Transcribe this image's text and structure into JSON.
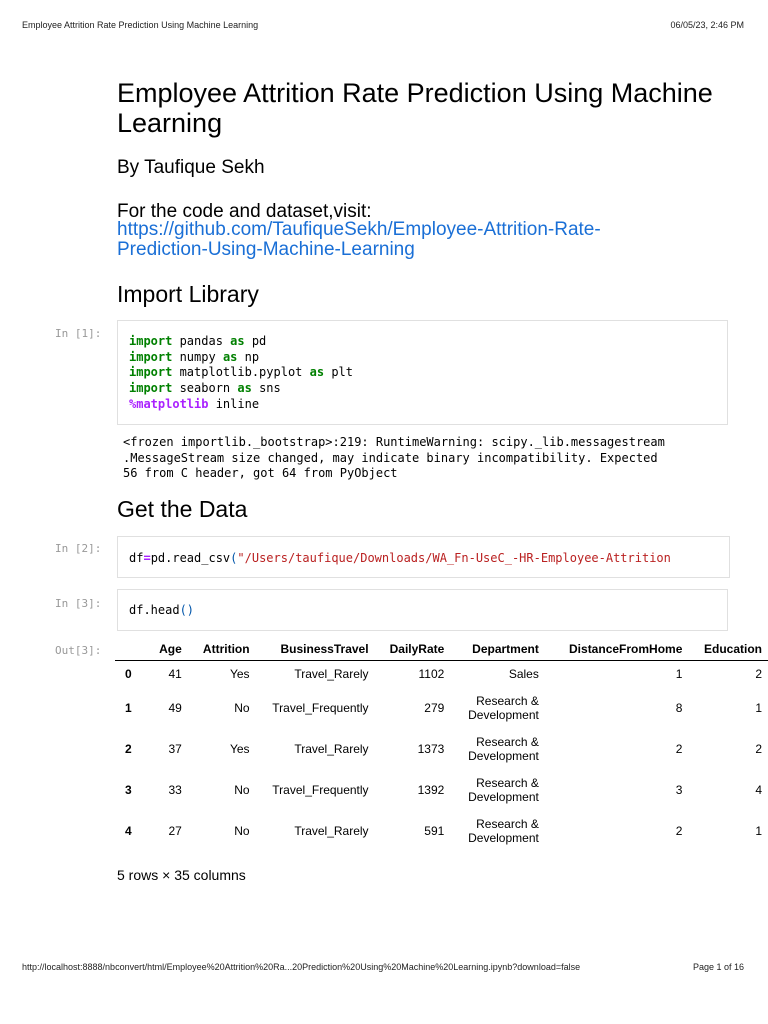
{
  "header": {
    "title": "Employee Attrition Rate Prediction Using Machine Learning",
    "datetime": "06/05/23, 2:46 PM"
  },
  "footer": {
    "url": "http://localhost:8888/nbconvert/html/Employee%20Attrition%20Ra...20Prediction%20Using%20Machine%20Learning.ipynb?download=false",
    "page": "Page 1 of 16"
  },
  "title": "Employee Attrition Rate Prediction Using Machine Learning",
  "author": "By Taufique Sekh",
  "visit_text": "For the code and dataset,visit:",
  "link": "https://github.com/TaufiqueSekh/Employee-Attrition-Rate-Prediction-Using-Machine-Learning",
  "link_line1": "https://github.com/TaufiqueSekh/Employee-Attrition-Rate-",
  "link_line2": "Prediction-Using-Machine-Learning",
  "section1": "Import Library",
  "section2": "Get the Data",
  "cell1": {
    "prompt": "In [1]:",
    "lines": [
      [
        "import",
        " pandas ",
        "as",
        " pd"
      ],
      [
        "import",
        " numpy ",
        "as",
        " np"
      ],
      [
        "import",
        " matplotlib.pyplot ",
        "as",
        " plt"
      ],
      [
        "import",
        " seaborn ",
        "as",
        " sns"
      ]
    ],
    "magic": "%matplotlib",
    "magic_rest": " inline"
  },
  "cell1_output": "<frozen importlib._bootstrap>:219: RuntimeWarning: scipy._lib.messagestream\n.MessageStream size changed, may indicate binary incompatibility. Expected\n56 from C header, got 64 from PyObject",
  "cell2": {
    "prompt": "In [2]:",
    "a": "df",
    "op": "=",
    "b": "pd.read_csv",
    "p": "(",
    "s": "\"/Users/taufique/Downloads/WA_Fn-UseC_-HR-Employee-Attrition"
  },
  "cell3": {
    "prompt": "In [3]:",
    "a": "df.head",
    "p": "()"
  },
  "out3": {
    "prompt": "Out[3]:",
    "columns": [
      "",
      "Age",
      "Attrition",
      "BusinessTravel",
      "DailyRate",
      "Department",
      "DistanceFromHome",
      "Education"
    ],
    "rows": [
      [
        "0",
        "41",
        "Yes",
        "Travel_Rarely",
        "1102",
        "Sales",
        "1",
        "2"
      ],
      [
        "1",
        "49",
        "No",
        "Travel_Frequently",
        "279",
        "Research & Development",
        "8",
        "1"
      ],
      [
        "2",
        "37",
        "Yes",
        "Travel_Rarely",
        "1373",
        "Research & Development",
        "2",
        "2"
      ],
      [
        "3",
        "33",
        "No",
        "Travel_Frequently",
        "1392",
        "Research & Development",
        "3",
        "4"
      ],
      [
        "4",
        "27",
        "No",
        "Travel_Rarely",
        "591",
        "Research & Development",
        "2",
        "1"
      ]
    ],
    "shape": "5 rows × 35 columns"
  }
}
